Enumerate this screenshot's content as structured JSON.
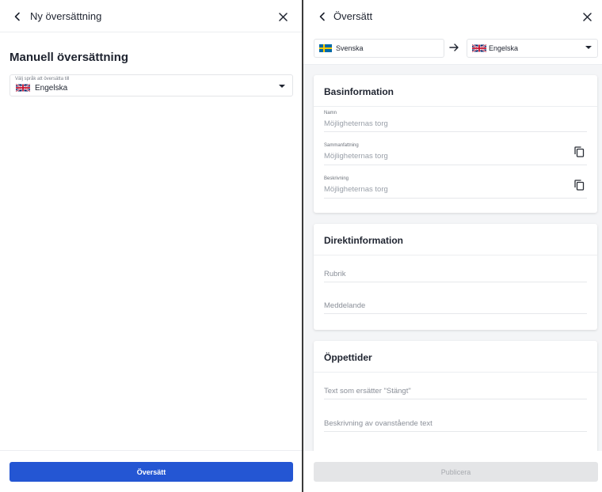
{
  "left_panel": {
    "header_title": "Ny översättning",
    "section_heading": "Manuell översättning",
    "language_select": {
      "label": "Välj språk att översätta till",
      "value": "Engelska",
      "flag": "uk-flag-icon"
    },
    "primary_button": "Översätt"
  },
  "right_panel": {
    "header_title": "Översätt",
    "source_language": {
      "value": "Svenska",
      "flag": "sweden-flag-icon"
    },
    "target_language": {
      "value": "Engelska",
      "flag": "uk-flag-icon"
    },
    "cards": {
      "basic": {
        "title": "Basinformation",
        "fields": [
          {
            "label": "Namn",
            "value": "Möjligheternas torg"
          },
          {
            "label": "Sammanfattning",
            "value": "Möjligheternas torg"
          },
          {
            "label": "Beskrivning",
            "value": "Möjligheternas torg"
          }
        ]
      },
      "direct": {
        "title": "Direktinformation",
        "fields": [
          {
            "placeholder": "Rubrik"
          },
          {
            "placeholder": "Meddelande"
          }
        ]
      },
      "hours": {
        "title": "Öppettider",
        "fields": [
          {
            "placeholder": "Text som ersätter \"Stängt\""
          },
          {
            "placeholder": "Beskrivning av ovanstående text"
          }
        ]
      }
    },
    "publish_button": "Publicera"
  },
  "colors": {
    "primary": "#2456d3",
    "disabled_bg": "#e4e5e7",
    "content_bg": "#f4f5f7"
  }
}
